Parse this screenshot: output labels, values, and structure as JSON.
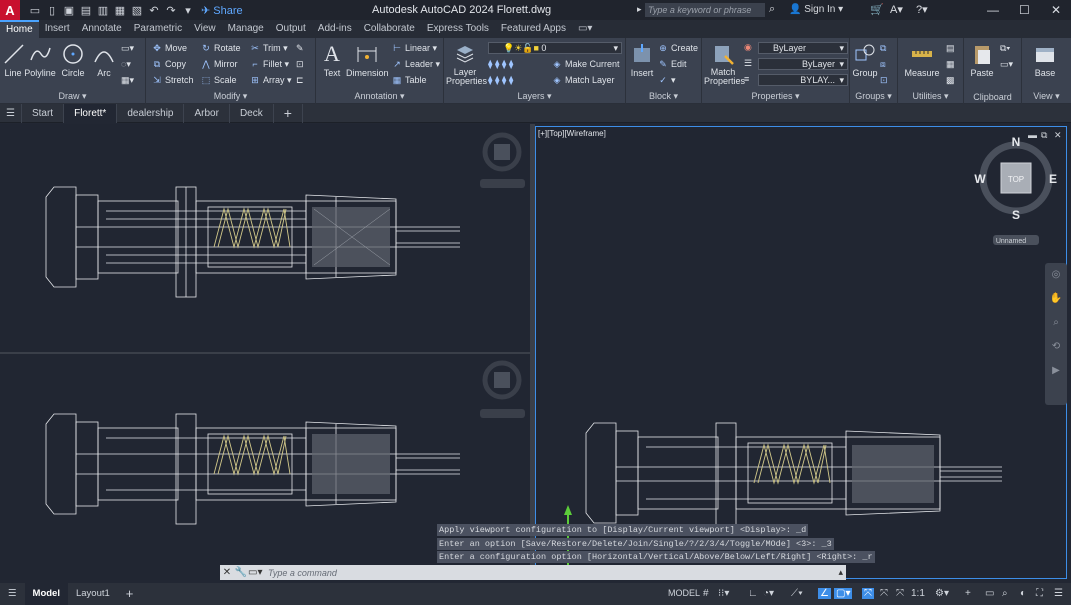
{
  "app": {
    "logo_letter": "A",
    "title": "Autodesk AutoCAD 2024   Florett.dwg",
    "share_label": "Share",
    "search_placeholder": "Type a keyword or phrase",
    "signin_label": "Sign In"
  },
  "ribbon_tabs": [
    "Home",
    "Insert",
    "Annotate",
    "Parametric",
    "View",
    "Manage",
    "Output",
    "Add-ins",
    "Collaborate",
    "Express Tools",
    "Featured Apps"
  ],
  "panels": {
    "draw": {
      "title": "Draw",
      "line": "Line",
      "polyline": "Polyline",
      "circle": "Circle",
      "arc": "Arc"
    },
    "modify": {
      "title": "Modify",
      "move": "Move",
      "rotate": "Rotate",
      "trim": "Trim",
      "copy": "Copy",
      "mirror": "Mirror",
      "fillet": "Fillet",
      "stretch": "Stretch",
      "scale": "Scale",
      "array": "Array"
    },
    "annotation": {
      "title": "Annotation",
      "text": "Text",
      "dimension": "Dimension",
      "linear": "Linear",
      "leader": "Leader",
      "table": "Table"
    },
    "layers": {
      "title": "Layers",
      "layer_properties": "Layer Properties",
      "current_layer": "0",
      "make_current": "Make Current",
      "match_layer": "Match Layer"
    },
    "block": {
      "title": "Block",
      "insert": "Insert",
      "create": "Create",
      "edit": "Edit"
    },
    "properties": {
      "title": "Properties",
      "match_properties": "Match Properties",
      "color": "ByLayer",
      "linetype": "ByLayer",
      "lineweight": "BYLAY..."
    },
    "groups": {
      "title": "Groups",
      "group": "Group"
    },
    "utilities": {
      "title": "Utilities",
      "measure": "Measure"
    },
    "clipboard": {
      "title": "Clipboard",
      "paste": "Paste"
    },
    "view": {
      "title": "View",
      "base": "Base"
    }
  },
  "doc_tabs": [
    "Start",
    "Florett*",
    "dealership",
    "Arbor",
    "Deck"
  ],
  "viewport": {
    "label": "[+][Top][Wireframe]",
    "compass": {
      "n": "N",
      "s": "S",
      "e": "E",
      "w": "W",
      "top": "TOP"
    },
    "ucs": "Unnamed"
  },
  "command": {
    "history": [
      "Apply viewport configuration to [Display/Current viewport] <Display>: _d",
      "Enter an option [Save/Restore/Delete/Join/Single/?/2/3/4/Toggle/MOde] <3>: _3",
      "Enter a configuration option [Horizontal/Vertical/Above/Below/Left/Right] <Right>: _r"
    ],
    "placeholder": "Type a command"
  },
  "status": {
    "layout_tabs": [
      "Model",
      "Layout1"
    ],
    "model_label": "MODEL",
    "scale": "1:1"
  },
  "colors": {
    "accent": "#3d8ee8",
    "brand_red": "#c8102e",
    "drawing_lines": "#e6e8ec",
    "spring": "#d2c98a"
  }
}
